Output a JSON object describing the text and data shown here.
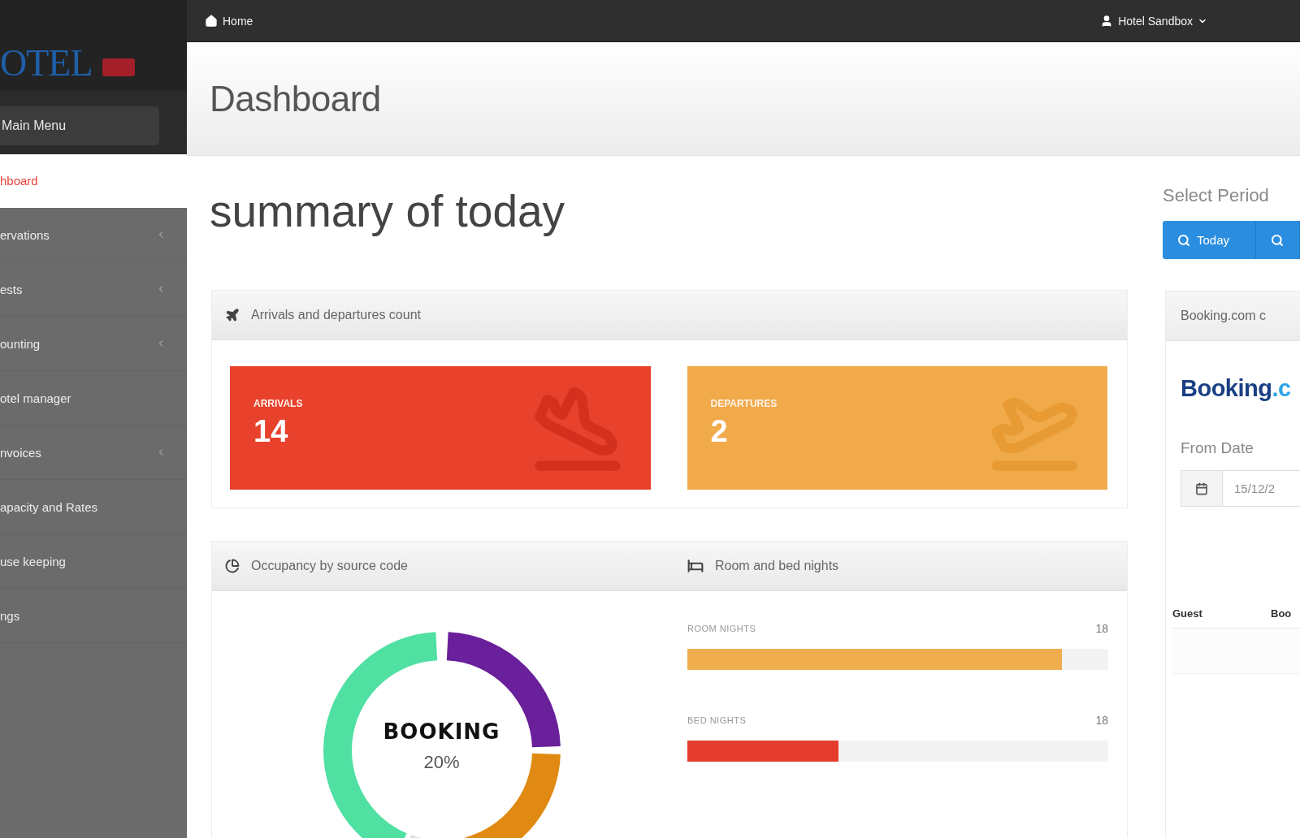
{
  "top_bar": {
    "home_link": "Home",
    "user_menu": "Hotel Sandbox"
  },
  "logo": {
    "text": "OTEL"
  },
  "sidebar": {
    "menu_button": "Main Menu",
    "items": [
      {
        "label": "hboard",
        "selected": true,
        "has_submenu": false
      },
      {
        "label": "ervations",
        "selected": false,
        "has_submenu": true
      },
      {
        "label": "ests",
        "selected": false,
        "has_submenu": true
      },
      {
        "label": "ounting",
        "selected": false,
        "has_submenu": true
      },
      {
        "label": "otel manager",
        "selected": false,
        "has_submenu": false
      },
      {
        "label": "nvoices",
        "selected": false,
        "has_submenu": true
      },
      {
        "label": "apacity and Rates",
        "selected": false,
        "has_submenu": false
      },
      {
        "label": "use keeping",
        "selected": false,
        "has_submenu": false
      },
      {
        "label": "ngs",
        "selected": false,
        "has_submenu": false
      }
    ]
  },
  "page_header": {
    "title": "Dashboard"
  },
  "summary": {
    "title": "summary of today"
  },
  "period": {
    "label": "Select Period",
    "buttons": [
      {
        "kind": "labeled",
        "label": "Today"
      },
      {
        "kind": "icon"
      }
    ]
  },
  "arrivals_panel": {
    "title": "Arrivals and departures count",
    "cards": [
      {
        "kind": "arrivals",
        "label": "ARRIVALS",
        "value": "14",
        "color": "#e8412c"
      },
      {
        "kind": "departures",
        "label": "DEPARTURES",
        "value": "2",
        "color": "#f0aa4a"
      }
    ]
  },
  "occupancy_panel": {
    "title": "Occupancy by source code",
    "donut_center": {
      "label": "BOOKING",
      "value": "20%"
    }
  },
  "nights_panel": {
    "title": "Room and bed nights",
    "bars": [
      {
        "label": "ROOM NIGHTS",
        "reading": "18",
        "level": 0.89,
        "color": "#f0ad4e"
      },
      {
        "label": "BED NIGHTS",
        "reading": "18",
        "level": 0.36,
        "color": "#e43d2d"
      }
    ]
  },
  "booking_panel": {
    "title": "Booking.com c",
    "logo": {
      "name": "Booking",
      "suffix": ".c"
    },
    "from_date": {
      "label": "From Date",
      "value": "15/12/2"
    },
    "table": {
      "columns": [
        "Guest",
        "Boo"
      ]
    }
  }
}
